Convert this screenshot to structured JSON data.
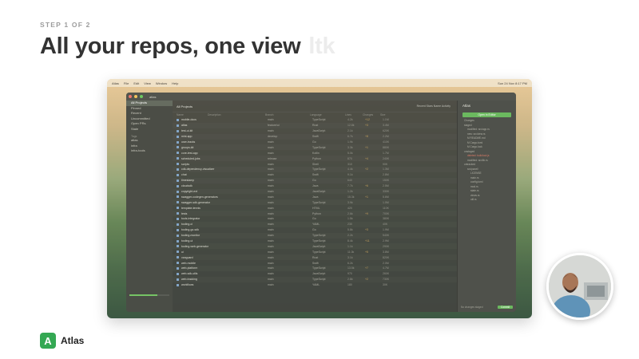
{
  "step": "STEP 1 OF 2",
  "headline": "All your repos, one view",
  "ghost_text": "ltk",
  "brand": {
    "name": "Atlas",
    "logo_letter": "A",
    "color": "#34a853"
  },
  "app": {
    "menu": [
      "Atlas",
      "File",
      "Edit",
      "View",
      "Window",
      "Help"
    ],
    "menu_right": "Sun 24 Nov 8:17 PM",
    "window_title": "atlas",
    "sidebar": {
      "items": [
        "All Projects",
        "Pinned",
        "Recent",
        "Uncommitted",
        "Open PRs",
        "Stale"
      ],
      "groups": [
        {
          "label": "Tags",
          "items": [
            "atlas",
            "infra",
            "infra-tools"
          ]
        }
      ]
    },
    "list_title": "All Projects",
    "tabs": "Recent  Stars  Name  Activity",
    "columns": [
      "Name",
      "Description",
      "Branch",
      "Language",
      "Lines",
      "Changes",
      "Size"
    ],
    "rows": [
      [
        "mobile-docs",
        "",
        "main",
        "TypeScript",
        "4.2k",
        "+12",
        "1.1M"
      ],
      [
        "atlas",
        "",
        "feature/ui",
        "Rust",
        "12.8k",
        "+3",
        "3.4M"
      ],
      [
        "test-ui-kit",
        "",
        "main",
        "JavaScript",
        "2.1k",
        "",
        "620K"
      ],
      [
        "mini-app",
        "",
        "develop",
        "Swift",
        "6.7k",
        "+8",
        "2.2M"
      ],
      [
        "user-tracks",
        "",
        "main",
        "Go",
        "1.9k",
        "",
        "410K"
      ],
      [
        "groups-kit",
        "",
        "main",
        "TypeScript",
        "3.3k",
        "+1",
        "880K"
      ],
      [
        "core-test-app",
        "",
        "main",
        "Kotlin",
        "5.0k",
        "",
        "1.7M"
      ],
      [
        "scheduled-jobs",
        "",
        "release",
        "Python",
        "870",
        "+4",
        "240K"
      ],
      [
        "scripts",
        "",
        "main",
        "Shell",
        "310",
        "",
        "90K"
      ],
      [
        "cdk-dependency-visualizer",
        "",
        "main",
        "TypeScript",
        "4.4k",
        "+2",
        "1.3M"
      ],
      [
        "chat",
        "",
        "main",
        "Swift",
        "9.1k",
        "",
        "2.8M"
      ],
      [
        "timestamp",
        "",
        "main",
        "Go",
        "640",
        "",
        "150K"
      ],
      [
        "cloudsdk",
        "",
        "main",
        "Java",
        "7.7k",
        "+6",
        "2.5M"
      ],
      [
        "copyright-ext",
        "",
        "main",
        "JavaScript",
        "1.2k",
        "",
        "330K"
      ],
      [
        "swagger-codegen-generators",
        "",
        "main",
        "Java",
        "15.3k",
        "+1",
        "5.6M"
      ],
      [
        "swagger-sdk-generator",
        "",
        "main",
        "TypeScript",
        "3.9k",
        "",
        "1.0M"
      ],
      [
        "template-tennis",
        "",
        "main",
        "HTML",
        "420",
        "",
        "110K"
      ],
      [
        "tests",
        "",
        "main",
        "Python",
        "2.6k",
        "+9",
        "700K"
      ],
      [
        "tools-integrator",
        "",
        "main",
        "Go",
        "1.5k",
        "",
        "380K"
      ],
      [
        "tooling-ci",
        "",
        "main",
        "YAML",
        "230",
        "",
        "40K"
      ],
      [
        "tooling-go-sdk",
        "",
        "main",
        "Go",
        "5.8k",
        "+3",
        "1.9M"
      ],
      [
        "tooling-monitor",
        "",
        "main",
        "TypeScript",
        "2.2k",
        "",
        "540K"
      ],
      [
        "tooling-ui",
        "",
        "main",
        "TypeScript",
        "8.4k",
        "+11",
        "2.9M"
      ],
      [
        "tooling-web-generator",
        "",
        "main",
        "JavaScript",
        "1.1k",
        "",
        "290K"
      ],
      [
        "ui",
        "",
        "main",
        "TypeScript",
        "11.0k",
        "+5",
        "3.8M"
      ],
      [
        "vanguard",
        "",
        "main",
        "Rust",
        "3.1k",
        "",
        "820K"
      ],
      [
        "web-mobile",
        "",
        "main",
        "Swift",
        "6.2k",
        "",
        "2.0M"
      ],
      [
        "web-platform",
        "",
        "main",
        "TypeScript",
        "13.5k",
        "+7",
        "4.7M"
      ],
      [
        "web-sdk-utils",
        "",
        "main",
        "JavaScript",
        "970",
        "",
        "260K"
      ],
      [
        "web-tracking",
        "",
        "main",
        "TypeScript",
        "2.8k",
        "+2",
        "730K"
      ],
      [
        "workflows",
        "",
        "main",
        "YAML",
        "180",
        "",
        "30K"
      ]
    ],
    "panel": {
      "title": "Atlas",
      "action": "Open in Editor",
      "lines": [
        "Changes",
        "staged",
        "  modified: src/app.rs",
        "  new: src/view.rs",
        "  M README.md",
        "  M Cargo.toml",
        "  M Cargo.lock",
        "unstaged",
        "  deleted: build/out.js",
        "  modified: src/lib.rs",
        "untracked",
        "  src/panel/",
        "    LICENSE",
        "    main.rs",
        "    config.toml",
        "    mod.rs",
        "    state.rs",
        "    views.rs",
        "    util.rs"
      ],
      "footer_left": "No changes staged",
      "footer_right": "Commit"
    },
    "progress": 0.7
  }
}
